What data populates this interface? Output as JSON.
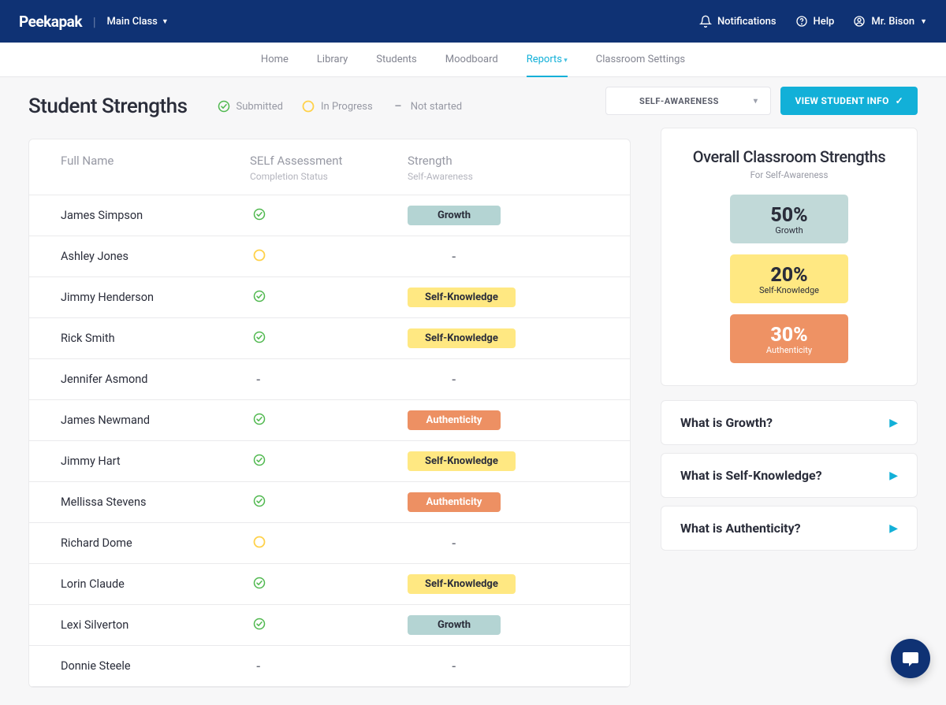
{
  "topbar": {
    "brand": "Peekapak",
    "class_label": "Main Class",
    "notifications_label": "Notifications",
    "help_label": "Help",
    "user_label": "Mr. Bison"
  },
  "nav": {
    "home": "Home",
    "library": "Library",
    "students": "Students",
    "moodboard": "Moodboard",
    "reports": "Reports",
    "classroom_settings": "Classroom Settings"
  },
  "page": {
    "title": "Student Strengths"
  },
  "legend": {
    "submitted": "Submitted",
    "in_progress": "In Progress",
    "not_started": "Not started"
  },
  "controls": {
    "dropdown_value": "SELF-AWARENESS",
    "view_button": "VIEW STUDENT INFO"
  },
  "table": {
    "col_name": "Full Name",
    "col_assessment": "SELf Assessment",
    "col_assessment_sub": "Completion Status",
    "col_strength": "Strength",
    "col_strength_sub": "Self-Awareness"
  },
  "students": [
    {
      "name": "James Simpson",
      "status": "submitted",
      "strength": "Growth"
    },
    {
      "name": "Ashley Jones",
      "status": "inprogress",
      "strength": "-"
    },
    {
      "name": "Jimmy Henderson",
      "status": "submitted",
      "strength": "Self-Knowledge"
    },
    {
      "name": "Rick Smith",
      "status": "submitted",
      "strength": "Self-Knowledge"
    },
    {
      "name": "Jennifer Asmond",
      "status": "notstarted",
      "strength": "-"
    },
    {
      "name": "James Newmand",
      "status": "submitted",
      "strength": "Authenticity"
    },
    {
      "name": "Jimmy Hart",
      "status": "submitted",
      "strength": "Self-Knowledge"
    },
    {
      "name": "Mellissa Stevens",
      "status": "submitted",
      "strength": "Authenticity"
    },
    {
      "name": "Richard Dome",
      "status": "inprogress",
      "strength": "-"
    },
    {
      "name": "Lorin Claude",
      "status": "submitted",
      "strength": "Self-Knowledge"
    },
    {
      "name": "Lexi Silverton",
      "status": "submitted",
      "strength": "Growth"
    },
    {
      "name": "Donnie Steele",
      "status": "notstarted",
      "strength": "-"
    }
  ],
  "overall": {
    "title": "Overall Classroom Strengths",
    "subtitle": "For Self-Awareness",
    "stats": [
      {
        "pct": "50%",
        "label": "Growth",
        "class": "stat-growth"
      },
      {
        "pct": "20%",
        "label": "Self-Knowledge",
        "class": "stat-selfknowledge"
      },
      {
        "pct": "30%",
        "label": "Authenticity",
        "class": "stat-authenticity"
      }
    ]
  },
  "accordions": [
    {
      "label": "What is Growth?"
    },
    {
      "label": "What is Self-Knowledge?"
    },
    {
      "label": "What is Authenticity?"
    }
  ],
  "pill_classes": {
    "Growth": "pill-growth",
    "Self-Knowledge": "pill-selfknowledge",
    "Authenticity": "pill-authenticity"
  }
}
